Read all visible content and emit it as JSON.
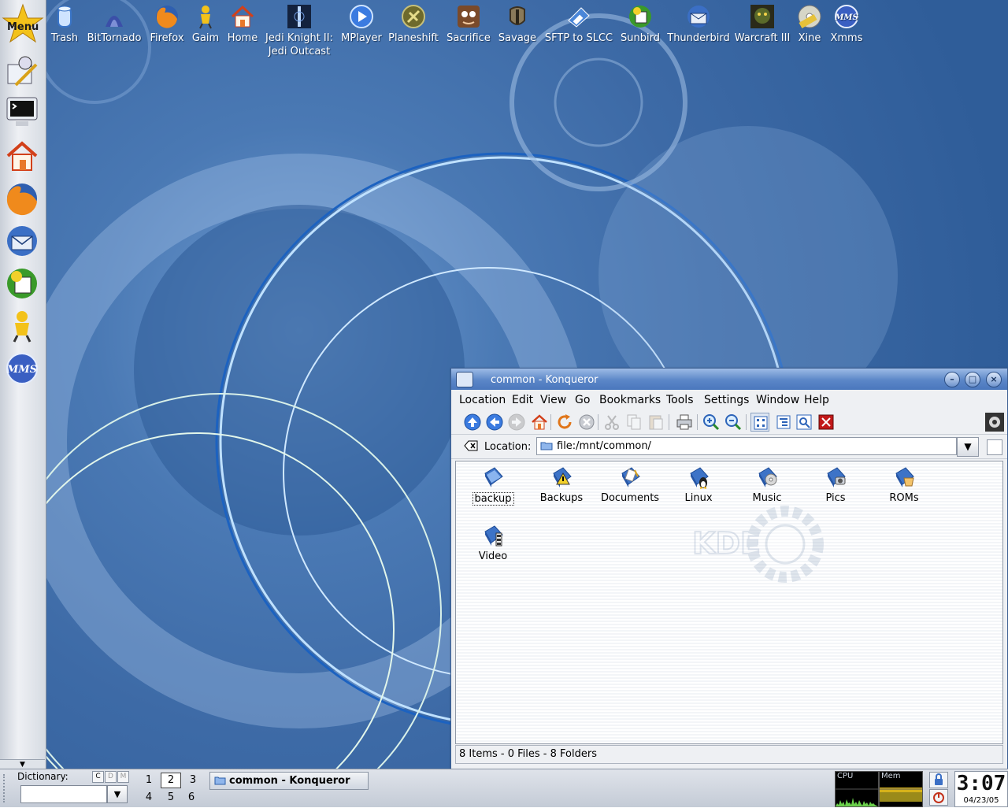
{
  "left_panel": {
    "menu_label": "Menu",
    "launchers": [
      "kwrite-icon",
      "terminal-icon",
      "home-icon",
      "firefox-icon",
      "thunderbird-icon",
      "sunbird-icon",
      "gaim-icon",
      "xmms-icon"
    ]
  },
  "desktop_icons": [
    {
      "label": "Trash",
      "icon": "trash-icon"
    },
    {
      "label": "BitTornado",
      "icon": "bittornado-icon"
    },
    {
      "label": "Firefox",
      "icon": "firefox-icon"
    },
    {
      "label": "Gaim",
      "icon": "gaim-icon"
    },
    {
      "label": "Home",
      "icon": "home-icon"
    },
    {
      "label": "Jedi Knight II:",
      "label2": "Jedi Outcast",
      "icon": "jedi-knight-icon"
    },
    {
      "label": "MPlayer",
      "icon": "mplayer-icon"
    },
    {
      "label": "Planeshift",
      "icon": "planeshift-icon"
    },
    {
      "label": "Sacrifice",
      "icon": "sacrifice-icon"
    },
    {
      "label": "Savage",
      "icon": "savage-icon"
    },
    {
      "label": "SFTP to SLCC",
      "icon": "sftp-icon"
    },
    {
      "label": "Sunbird",
      "icon": "sunbird-icon"
    },
    {
      "label": "Thunderbird",
      "icon": "thunderbird-icon"
    },
    {
      "label": "Warcraft III",
      "icon": "warcraft-icon"
    },
    {
      "label": "Xine",
      "icon": "xine-icon"
    },
    {
      "label": "Xmms",
      "icon": "xmms-icon"
    }
  ],
  "window": {
    "title": "common - Konqueror",
    "menus": [
      "Location",
      "Edit",
      "View",
      "Go",
      "Bookmarks",
      "Tools",
      "Settings",
      "Window",
      "Help"
    ],
    "location_label": "Location:",
    "location_value": "file:/mnt/common/",
    "files": [
      {
        "name": "backup",
        "icon": "folder-backup-icon"
      },
      {
        "name": "Backups",
        "icon": "folder-warning-icon"
      },
      {
        "name": "Documents",
        "icon": "folder-documents-icon"
      },
      {
        "name": "Linux",
        "icon": "folder-linux-icon"
      },
      {
        "name": "Music",
        "icon": "folder-music-icon"
      },
      {
        "name": "Pics",
        "icon": "folder-pictures-icon"
      },
      {
        "name": "ROMs",
        "icon": "folder-roms-icon"
      },
      {
        "name": "Video",
        "icon": "folder-video-icon"
      }
    ],
    "status": "8 Items - 0 Files - 8 Folders"
  },
  "bottom_panel": {
    "dictionary_label": "Dictionary:",
    "dict_buttons": [
      "C",
      "D",
      "M"
    ],
    "desktops": [
      "1",
      "2",
      "3",
      "4",
      "5",
      "6"
    ],
    "task_label": "common - Konqueror",
    "cpu_label": "CPU",
    "mem_label": "Mem",
    "clock_time": "3:07",
    "clock_date": "04/23/05"
  },
  "colors": {
    "desktop": "#3d6aa6",
    "titlebar": "#5b86c7",
    "folder": "#3d73c7"
  }
}
